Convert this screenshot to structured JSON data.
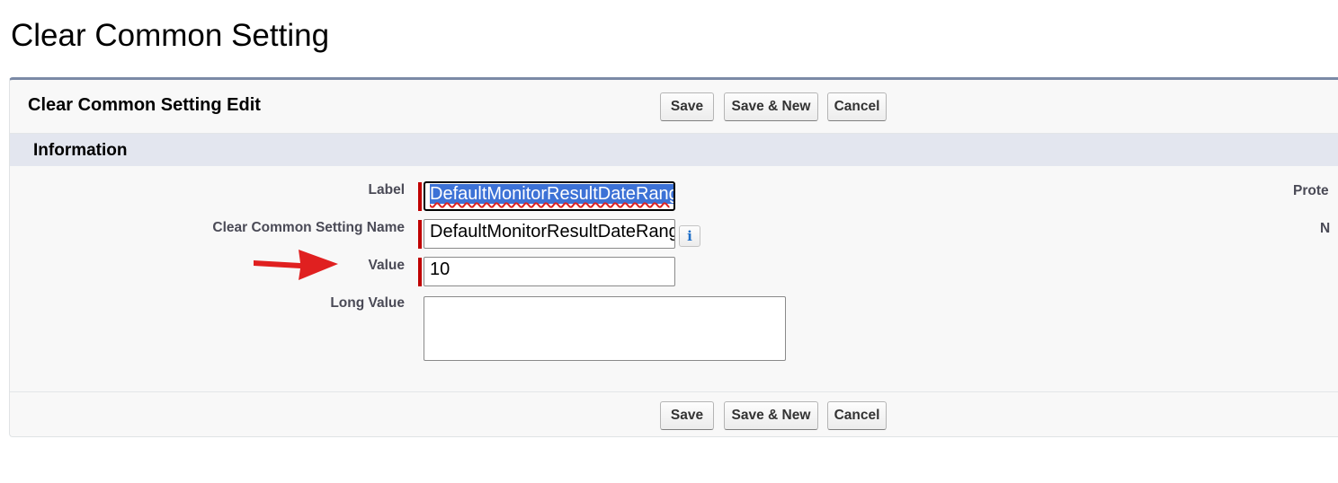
{
  "page": {
    "title": "Clear Common Setting"
  },
  "edit": {
    "title": "Clear Common Setting Edit",
    "buttons": {
      "save": "Save",
      "save_new": "Save & New",
      "cancel": "Cancel"
    }
  },
  "section": {
    "title": "Information"
  },
  "fields": {
    "label": {
      "label": "Label",
      "value": "DefaultMonitorResultDateRange",
      "selected": true,
      "required": true
    },
    "name": {
      "label": "Clear Common Setting Name",
      "value": "DefaultMonitorResultDateRange",
      "required": true,
      "help_icon": "info-icon"
    },
    "value": {
      "label": "Value",
      "value": "10",
      "required": true
    },
    "long_value": {
      "label": "Long Value",
      "value": ""
    }
  },
  "right_column": {
    "labels": [
      "Prote",
      "N"
    ]
  },
  "annotation": {
    "icon": "red-arrow-icon",
    "color": "#e02020"
  },
  "colors": {
    "required": "#c00000",
    "panel_border": "#7b8aa6",
    "section_header": "#e3e6ef",
    "selection": "#3d72d6"
  }
}
